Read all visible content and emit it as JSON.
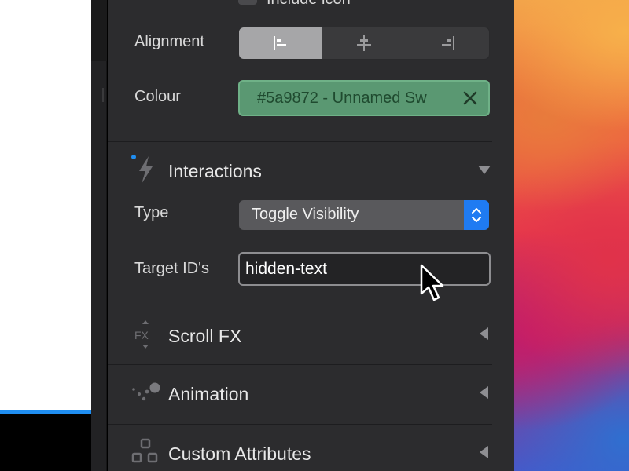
{
  "top_row": {
    "label": "Include icon"
  },
  "alignment": {
    "label": "Alignment",
    "options": [
      "left-align-icon",
      "center-align-icon",
      "right-align-icon"
    ],
    "selected": 0
  },
  "colour": {
    "label": "Colour",
    "value": "#5a9872 - Unnamed Sw",
    "swatch": "#5a9872"
  },
  "interactions": {
    "title": "Interactions",
    "type_label": "Type",
    "type_value": "Toggle Visibility",
    "target_label": "Target ID's",
    "target_value": "hidden-text"
  },
  "sections": {
    "scroll_fx": "Scroll FX",
    "animation": "Animation",
    "custom_attributes": "Custom Attributes"
  },
  "colors": {
    "panel_bg": "#2c2c2e",
    "accent_blue": "#1f7bf2",
    "swatch_green": "#5a9872"
  }
}
